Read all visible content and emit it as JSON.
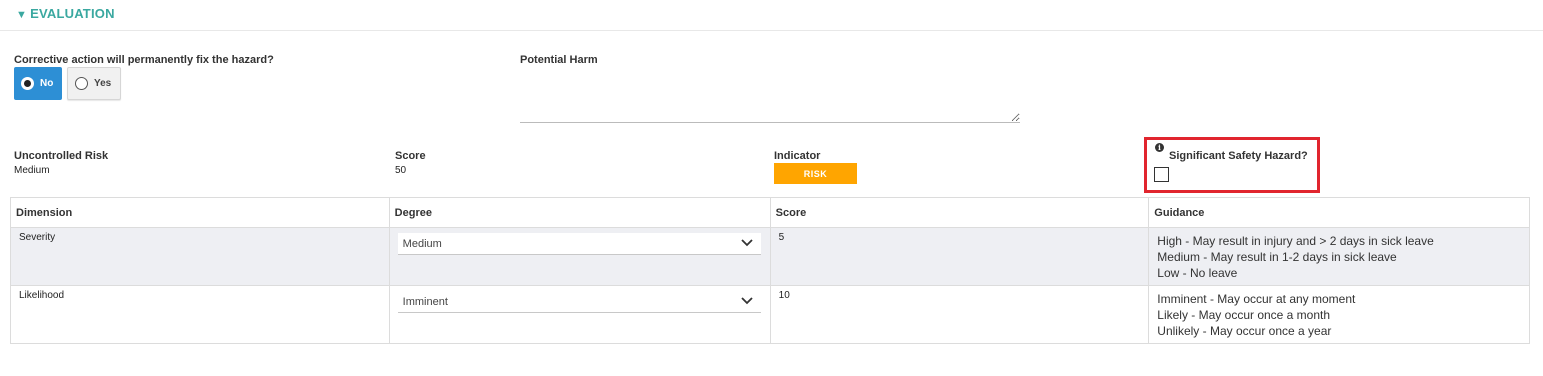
{
  "section": {
    "caret": "▼",
    "title": "EVALUATION"
  },
  "corrective": {
    "label": "Corrective action will permanently fix the hazard?",
    "options": [
      {
        "label": "No",
        "selected": true
      },
      {
        "label": "Yes",
        "selected": false
      }
    ]
  },
  "potential_harm": {
    "label": "Potential Harm",
    "value": ""
  },
  "uncontrolled_risk": {
    "label": "Uncontrolled Risk",
    "value": "Medium"
  },
  "score": {
    "label": "Score",
    "value": "50"
  },
  "indicator": {
    "label": "Indicator",
    "badge": "RISK",
    "badge_color": "#ffa500"
  },
  "significant": {
    "label": "Significant Safety Hazard?",
    "info_icon": "info-icon",
    "checked": false
  },
  "table": {
    "headers": [
      "Dimension",
      "Degree",
      "Score",
      "Guidance"
    ],
    "rows": [
      {
        "dimension": "Severity",
        "degree": "Medium",
        "score": "5",
        "guidance": [
          "High - May result in injury and > 2 days in sick leave",
          "Medium - May result in 1-2 days in sick leave",
          "Low - No leave"
        ]
      },
      {
        "dimension": "Likelihood",
        "degree": "Imminent",
        "score": "10",
        "guidance": [
          "Imminent - May occur at any moment",
          "Likely - May occur once a month",
          "Unlikely - May occur once a year"
        ]
      }
    ]
  },
  "colors": {
    "accent": "#3aa8a0",
    "selected_button": "#2d8fd5",
    "highlight": "#e1252e"
  }
}
